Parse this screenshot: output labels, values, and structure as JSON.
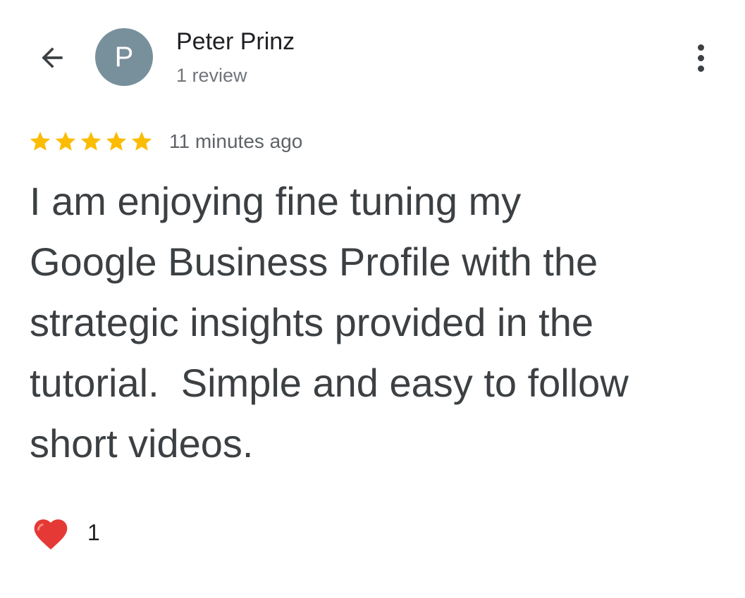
{
  "reviewer": {
    "avatar_initial": "P",
    "name": "Peter Prinz",
    "review_count": "1 review"
  },
  "rating": {
    "stars": 5,
    "max": 5,
    "time_ago": "11 minutes ago"
  },
  "review": {
    "text": "I am enjoying fine tuning my\nGoogle Business Profile with the\nstrategic insights provided in the\ntutorial.  Simple and easy to follow\nshort videos."
  },
  "reaction": {
    "icon": "heart-icon",
    "count": "1"
  },
  "icons": {
    "back": "arrow-back-icon",
    "more": "more-vert-icon"
  },
  "colors": {
    "star": "#fbbc04",
    "avatar_bg": "#78909c",
    "heart": "#e53935",
    "text": "#3c4043"
  }
}
